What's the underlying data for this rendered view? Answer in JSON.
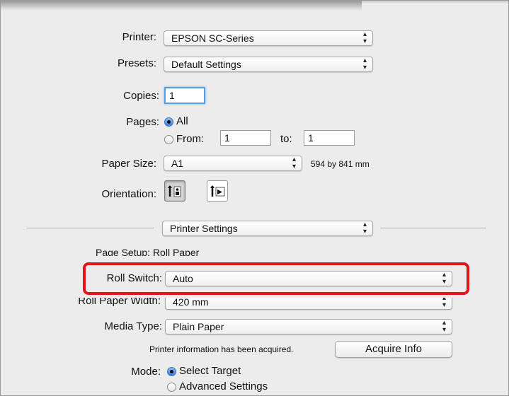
{
  "printer": {
    "label": "Printer:",
    "value": "EPSON SC-Series"
  },
  "presets": {
    "label": "Presets:",
    "value": "Default Settings"
  },
  "copies": {
    "label": "Copies:",
    "value": "1"
  },
  "pages": {
    "label": "Pages:",
    "all_label": "All",
    "from_label": "From:",
    "from_value": "1",
    "to_label": "to:",
    "to_value": "1"
  },
  "paper_size": {
    "label": "Paper Size:",
    "value": "A1",
    "dimensions": "594 by 841 mm"
  },
  "orientation": {
    "label": "Orientation:",
    "portrait_icon": "portrait-orientation-icon",
    "landscape_icon": "landscape-orientation-icon"
  },
  "section_popup": {
    "value": "Printer Settings"
  },
  "page_setup": {
    "text": "Page Setup: Roll Paper"
  },
  "roll_switch": {
    "label": "Roll Switch:",
    "value": "Auto"
  },
  "roll_paper_width": {
    "label": "Roll Paper Width:",
    "value": "420 mm"
  },
  "media_type": {
    "label": "Media Type:",
    "value": "Plain Paper"
  },
  "printer_info": {
    "text": "Printer information has been acquired.",
    "button": "Acquire Info"
  },
  "mode": {
    "label": "Mode:",
    "option1": "Select Target",
    "option2": "Advanced Settings"
  },
  "colors": {
    "highlight": "#e3141c",
    "focus": "#5b9be0"
  }
}
